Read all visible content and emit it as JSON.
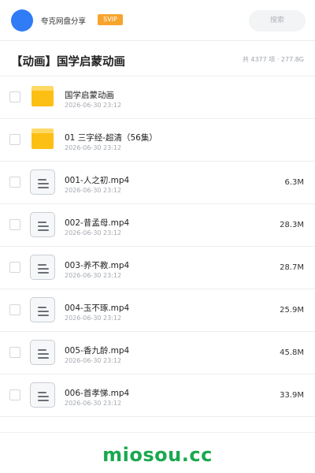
{
  "header": {
    "brand": "夸克网盘分享",
    "vip": "SVIP",
    "search_placeholder": "搜索"
  },
  "folder": {
    "title": "【动画】国学启蒙动画",
    "meta": "共 4377 项 · 277.8G"
  },
  "files": [
    {
      "name": "国学启蒙动画",
      "date": "2026-06-30 23:12",
      "size": "",
      "type": "folder"
    },
    {
      "name": "01 三字经-超清（56集）",
      "date": "2026-06-30 23:12",
      "size": "",
      "type": "folder"
    },
    {
      "name": "001-人之初.mp4",
      "date": "2026-06-30 23:12",
      "size": "6.3M",
      "type": "file"
    },
    {
      "name": "002-昔孟母.mp4",
      "date": "2026-06-30 23:12",
      "size": "28.3M",
      "type": "file"
    },
    {
      "name": "003-养不教.mp4",
      "date": "2026-06-30 23:12",
      "size": "28.7M",
      "type": "file"
    },
    {
      "name": "004-玉不琢.mp4",
      "date": "2026-06-30 23:12",
      "size": "25.9M",
      "type": "file"
    },
    {
      "name": "005-香九龄.mp4",
      "date": "2026-06-30 23:12",
      "size": "45.8M",
      "type": "file"
    },
    {
      "name": "006-首孝悌.mp4",
      "date": "2026-06-30 23:12",
      "size": "33.9M",
      "type": "file"
    }
  ],
  "footer": {
    "watermark": "miosou.cc"
  },
  "colors": {
    "accent_blue": "#2f7cf6",
    "vip_orange": "#f7a42d",
    "folder_yellow": "#fcbf14",
    "watermark_green": "#1aa84f"
  }
}
